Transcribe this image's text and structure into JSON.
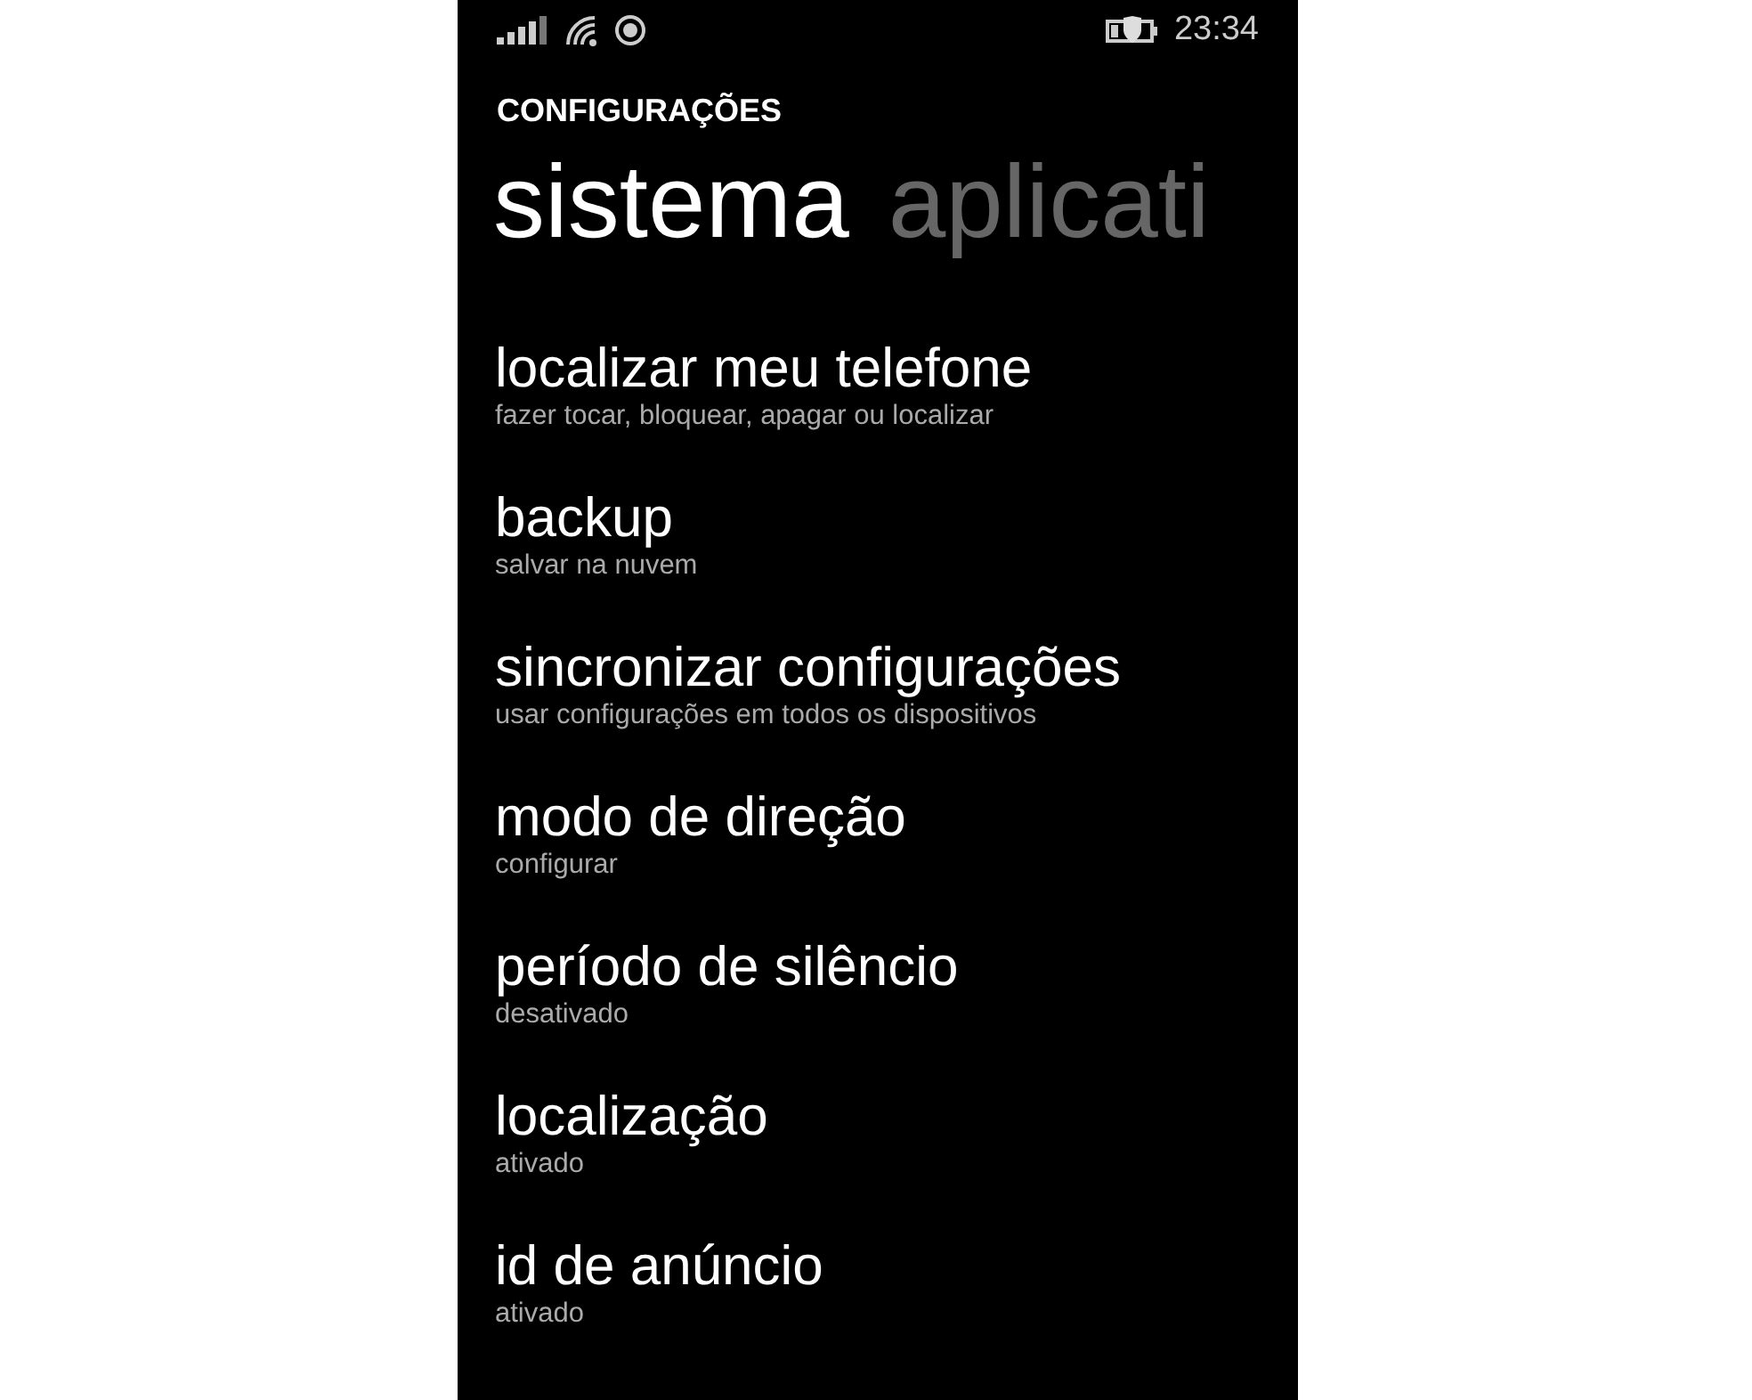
{
  "status_bar": {
    "time": "23:34"
  },
  "header": {
    "title": "CONFIGURAÇÕES"
  },
  "pivots": [
    {
      "label": "sistema",
      "selected": true
    },
    {
      "label": "aplicati",
      "selected": false
    }
  ],
  "items": [
    {
      "title": "localizar meu telefone",
      "subtitle": "fazer tocar, bloquear, apagar ou localizar"
    },
    {
      "title": "backup",
      "subtitle": "salvar na nuvem"
    },
    {
      "title": "sincronizar configurações",
      "subtitle": "usar configurações em todos os dispositivos"
    },
    {
      "title": "modo de direção",
      "subtitle": "configurar"
    },
    {
      "title": "período de silêncio",
      "subtitle": "desativado"
    },
    {
      "title": "localização",
      "subtitle": "ativado"
    },
    {
      "title": "id de anúncio",
      "subtitle": "ativado"
    }
  ]
}
